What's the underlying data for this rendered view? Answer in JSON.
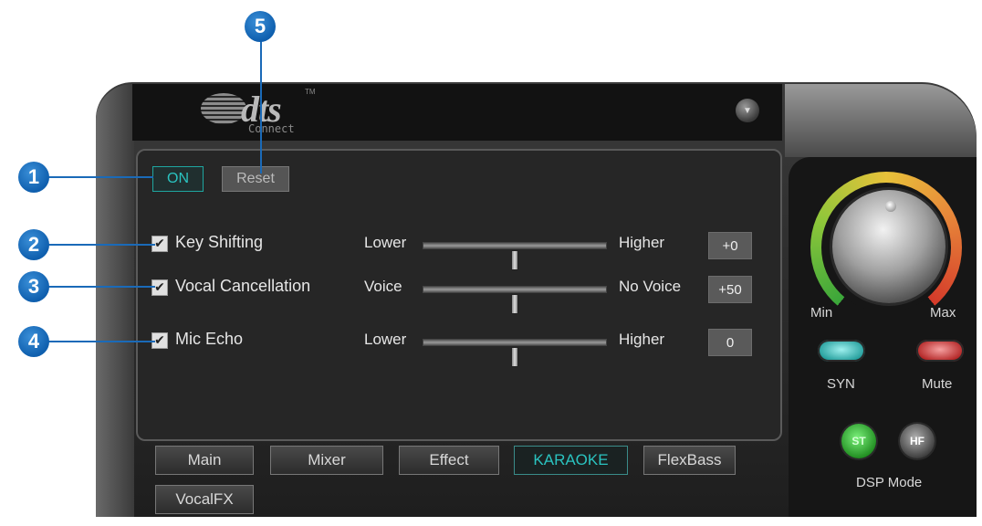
{
  "callouts": [
    "1",
    "2",
    "3",
    "4",
    "5"
  ],
  "logo": {
    "brand": "dts",
    "trademark": "TM",
    "subtitle": "Connect"
  },
  "icons": {
    "close": "close-icon",
    "check": "check-icon"
  },
  "controls": {
    "on_label": "ON",
    "reset_label": "Reset"
  },
  "rows": [
    {
      "label": "Key Shifting",
      "checked": true,
      "low": "Lower",
      "high": "Higher",
      "value": "+0",
      "level": 0.5
    },
    {
      "label": "Vocal Cancellation",
      "checked": true,
      "low": "Voice",
      "high": "No Voice",
      "value": "+50",
      "level": 0.5
    },
    {
      "label": "Mic Echo",
      "checked": true,
      "low": "Lower",
      "high": "Higher",
      "value": "0",
      "level": 0.5
    }
  ],
  "tabs": [
    {
      "label": "Main",
      "active": false
    },
    {
      "label": "Mixer",
      "active": false
    },
    {
      "label": "Effect",
      "active": false
    },
    {
      "label": "KARAOKE",
      "active": true
    },
    {
      "label": "FlexBass",
      "active": false
    },
    {
      "label": "VocalFX",
      "active": false
    }
  ],
  "volume": {
    "min_label": "Min",
    "max_label": "Max"
  },
  "buttons": {
    "syn_label": "SYN",
    "mute_label": "Mute",
    "st_label": "ST",
    "hf_label": "HF",
    "dsp_mode_label": "DSP Mode"
  },
  "colors": {
    "accent": "#2ac3c0",
    "callout": "#1a6ab8",
    "mute": "#b02020",
    "panel": "#262626"
  }
}
